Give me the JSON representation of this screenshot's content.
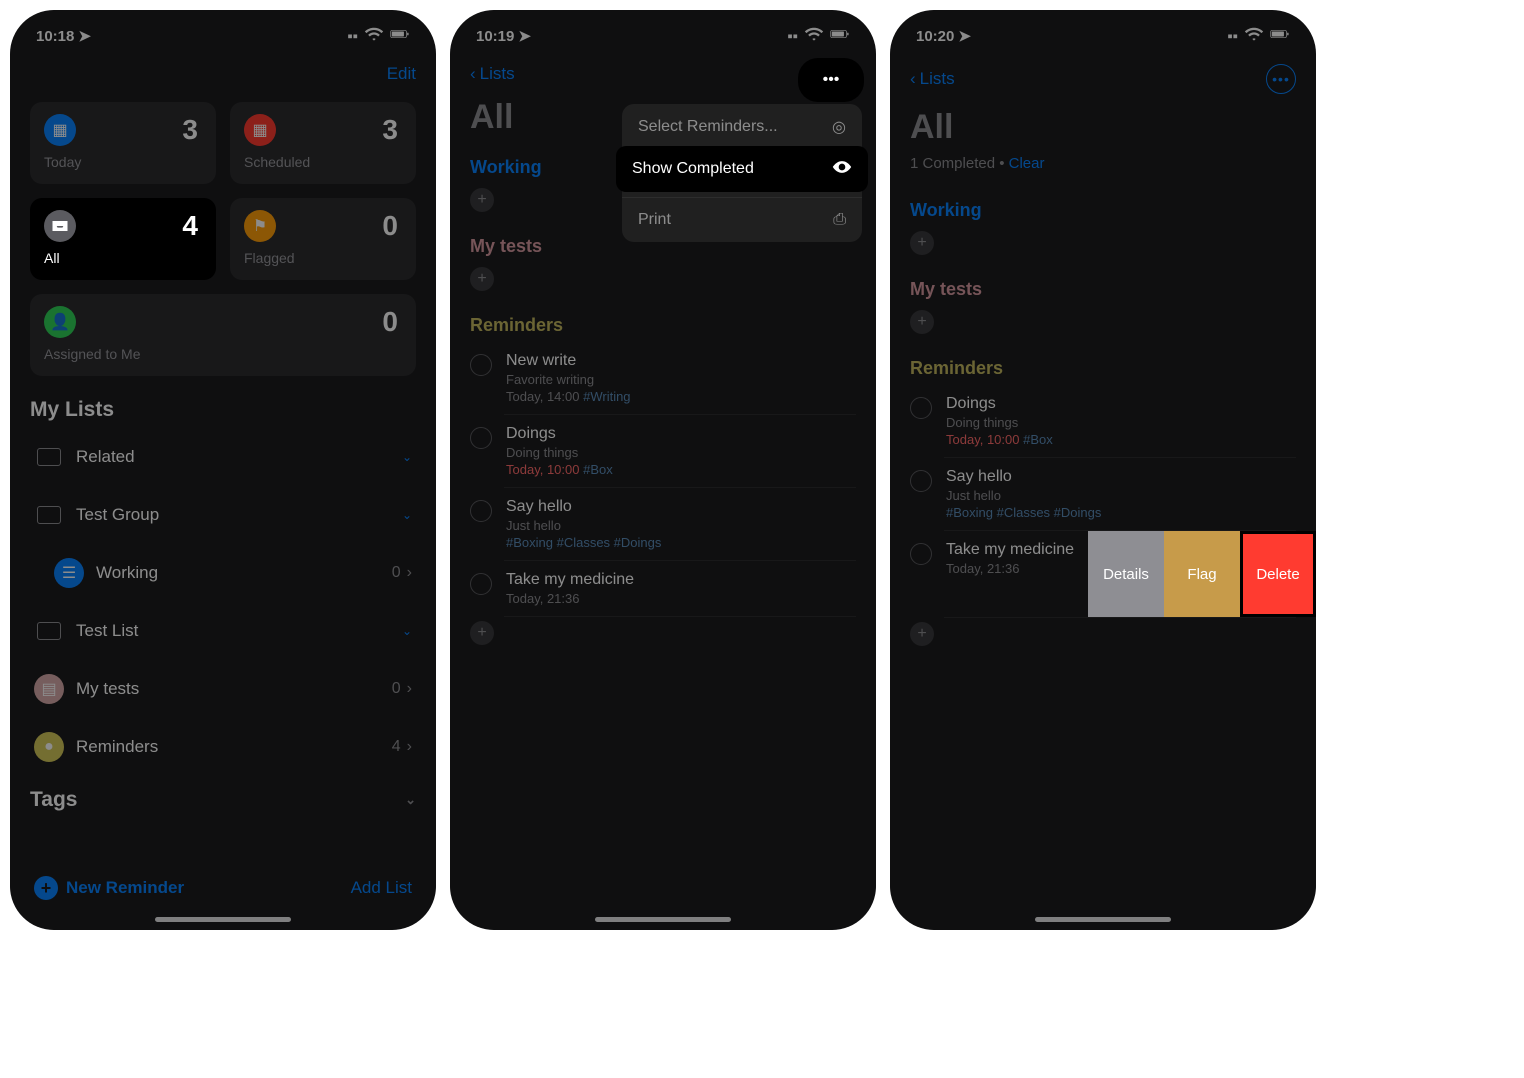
{
  "screen1": {
    "time": "10:18",
    "edit": "Edit",
    "tiles": {
      "today": {
        "label": "Today",
        "count": "3"
      },
      "scheduled": {
        "label": "Scheduled",
        "count": "3"
      },
      "all": {
        "label": "All",
        "count": "4"
      },
      "flagged": {
        "label": "Flagged",
        "count": "0"
      },
      "assigned": {
        "label": "Assigned to Me",
        "count": "0"
      }
    },
    "mylists_title": "My Lists",
    "lists": {
      "related": "Related",
      "testgroup": "Test Group",
      "working": {
        "name": "Working",
        "count": "0"
      },
      "testlist": "Test List",
      "mytests": {
        "name": "My tests",
        "count": "0"
      },
      "reminders": {
        "name": "Reminders",
        "count": "4"
      }
    },
    "tags_title": "Tags",
    "new_reminder": "New Reminder",
    "add_list": "Add List"
  },
  "screen2": {
    "time": "10:19",
    "back": "Lists",
    "title": "All",
    "menu": {
      "select": "Select Reminders...",
      "show": "Show Completed",
      "print": "Print"
    },
    "groups": {
      "working": "Working",
      "mytests": "My tests",
      "reminders": "Reminders"
    },
    "reminders": {
      "newwrite": {
        "title": "New write",
        "sub": "Favorite writing",
        "time": "Today, 14:00 ",
        "tag": "#Writing"
      },
      "doings": {
        "title": "Doings",
        "sub": "Doing things",
        "time": "Today, 10:00 ",
        "tag": "#Box"
      },
      "sayhello": {
        "title": "Say hello",
        "sub": "Just hello",
        "tags": "#Boxing #Classes #Doings"
      },
      "medicine": {
        "title": "Take my medicine",
        "time": "Today, 21:36"
      }
    }
  },
  "screen3": {
    "time": "10:20",
    "back": "Lists",
    "title": "All",
    "completed_text": "1 Completed  •  ",
    "clear": "Clear",
    "groups": {
      "working": "Working",
      "mytests": "My tests",
      "reminders": "Reminders"
    },
    "reminders": {
      "doings": {
        "title": "Doings",
        "sub": "Doing things",
        "time": "Today, 10:00 ",
        "tag": "#Box"
      },
      "sayhello": {
        "title": "Say hello",
        "sub": "Just hello",
        "tags": "#Boxing #Classes #Doings"
      },
      "medicine": {
        "title": "Take my medicine",
        "time": "Today, 21:36"
      }
    },
    "swipe": {
      "details": "Details",
      "flag": "Flag",
      "delete": "Delete"
    }
  }
}
